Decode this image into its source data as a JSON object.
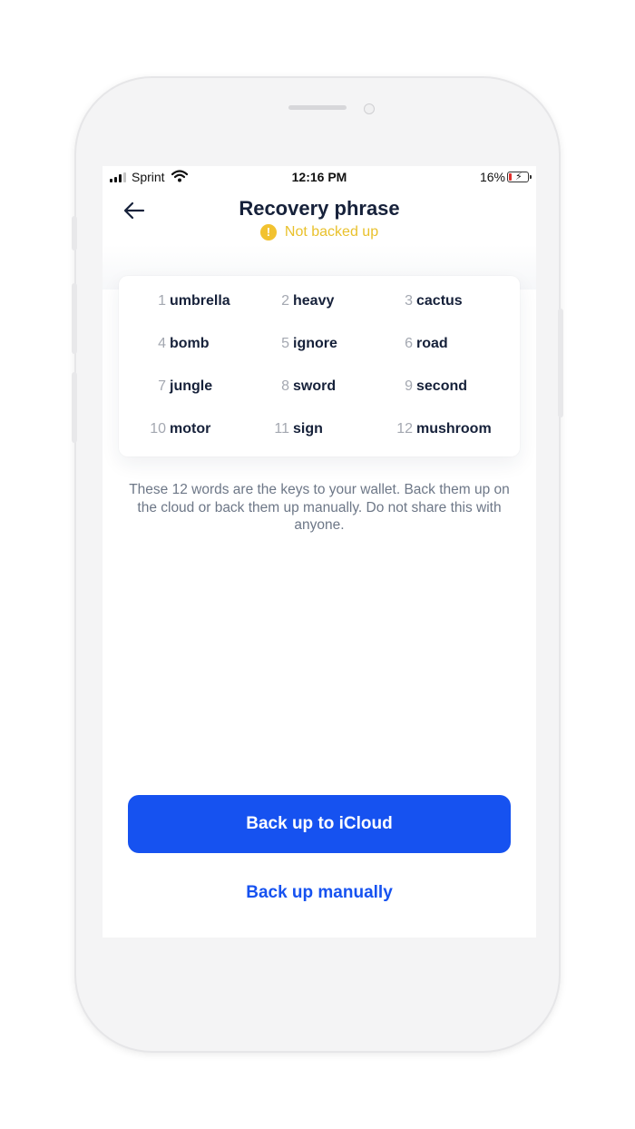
{
  "status_bar": {
    "carrier": "Sprint",
    "time": "12:16 PM",
    "battery": "16%",
    "battery_level": 0.16,
    "signal_bars": 3
  },
  "header": {
    "back_icon": "arrow-left-icon",
    "title": "Recovery phrase",
    "backup_status": "Not backed up",
    "status_icon": "warning-icon"
  },
  "words": [
    {
      "index": "1",
      "word": "umbrella"
    },
    {
      "index": "2",
      "word": "heavy"
    },
    {
      "index": "3",
      "word": "cactus"
    },
    {
      "index": "4",
      "word": "bomb"
    },
    {
      "index": "5",
      "word": "ignore"
    },
    {
      "index": "6",
      "word": "road"
    },
    {
      "index": "7",
      "word": "jungle"
    },
    {
      "index": "8",
      "word": "sword"
    },
    {
      "index": "9",
      "word": "second"
    },
    {
      "index": "10",
      "word": "motor"
    },
    {
      "index": "11",
      "word": "sign"
    },
    {
      "index": "12",
      "word": "mushroom"
    }
  ],
  "hint": "These 12 words are the keys to your wallet. Back them up on the cloud or back them up manually. Do not share this with anyone.",
  "actions": {
    "primary_label": "Back up to iCloud",
    "secondary_label": "Back up manually"
  },
  "colors": {
    "accent": "#1652f0",
    "warning": "#f2c230",
    "title": "#16213a"
  }
}
